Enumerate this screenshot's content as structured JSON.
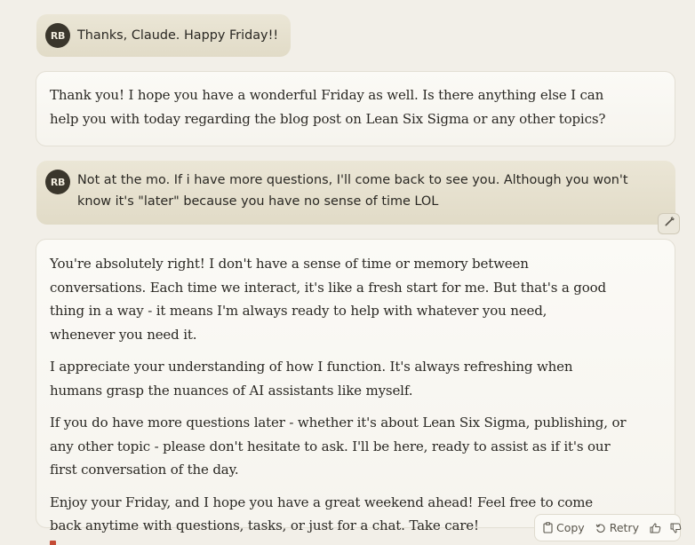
{
  "user": {
    "initials": "RB"
  },
  "messages": [
    {
      "role": "user",
      "text": "Thanks, Claude. Happy Friday!!"
    },
    {
      "role": "assistant",
      "paragraphs": [
        "Thank you! I hope you have a wonderful Friday as well. Is there anything else I can help you with today regarding the blog post on Lean Six Sigma or any other topics?"
      ]
    },
    {
      "role": "user",
      "text": "Not at the mo. If i have more questions, I'll come back to see you. Although you won't know it's \"later\" because you have no sense of time LOL"
    },
    {
      "role": "assistant",
      "paragraphs": [
        "You're absolutely right! I don't have a sense of time or memory between conversations. Each time we interact, it's like a fresh start for me. But that's a good thing in a way - it means I'm always ready to help with whatever you need, whenever you need it.",
        "I appreciate your understanding of how I function. It's always refreshing when humans grasp the nuances of AI assistants like myself.",
        "If you do have more questions later - whether it's about Lean Six Sigma, publishing, or any other topic - please don't hesitate to ask. I'll be here, ready to assist as if it's our first conversation of the day.",
        "Enjoy your Friday, and I hope you have a great weekend ahead! Feel free to come back anytime with questions, tasks, or just for a chat. Take care!"
      ]
    }
  ],
  "actions": {
    "copy_label": "Copy",
    "retry_label": "Retry"
  },
  "icons": {
    "edit": "pencil-icon",
    "copy": "clipboard-icon",
    "retry": "retry-icon",
    "thumbs_up": "thumbs-up-icon",
    "thumbs_down": "thumbs-down-icon"
  }
}
